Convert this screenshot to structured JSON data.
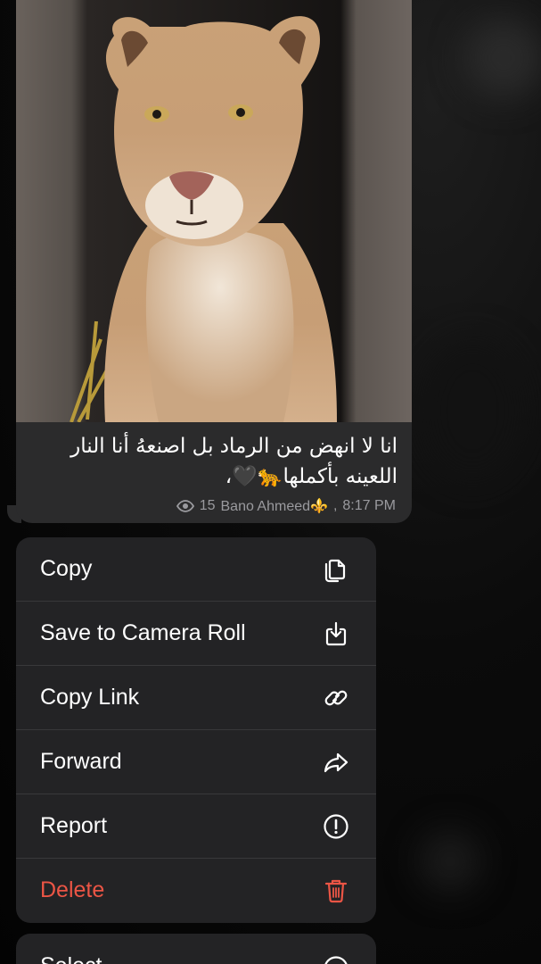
{
  "message": {
    "caption": "انا لا انهض من الرماد بل اصنعهُ أنا النار اللعينه بأكملها🐆🖤،",
    "views": "15",
    "author": "Bano Ahmeed⚜️",
    "time": "8:17 PM",
    "photo_icon": "lioness-photo"
  },
  "menu": {
    "items": [
      {
        "label": "Copy",
        "icon": "copy-icon"
      },
      {
        "label": "Save to Camera Roll",
        "icon": "save-download-icon"
      },
      {
        "label": "Copy Link",
        "icon": "link-icon"
      },
      {
        "label": "Forward",
        "icon": "forward-arrow-icon"
      },
      {
        "label": "Report",
        "icon": "report-exclamation-icon"
      },
      {
        "label": "Delete",
        "icon": "trash-icon",
        "color": "#eb5545"
      }
    ],
    "secondary": [
      {
        "label": "Select",
        "icon": "select-check-icon"
      }
    ]
  },
  "colors": {
    "menu_bg": "#232325",
    "bubble_bg": "#2b2b2c",
    "destructive": "#eb5545",
    "meta_text": "#9a9a9e"
  }
}
